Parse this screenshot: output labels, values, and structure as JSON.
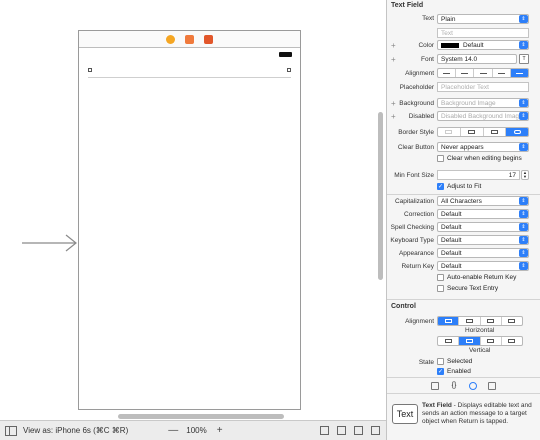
{
  "canvas": {
    "view_as_prefix": "View as:",
    "view_as_device": "iPhone 6s (⌘C ⌘R)",
    "zoom_out": "—",
    "zoom": "100%",
    "zoom_in": "+"
  },
  "inspector": {
    "text_field_title": "Text Field",
    "text_label": "Text",
    "text_value": "Plain",
    "text_placeholder": "Text",
    "color_label": "Color",
    "color_value": "Default",
    "font_label": "Font",
    "font_value": "System 14.0",
    "alignment_label": "Alignment",
    "placeholder_label": "Placeholder",
    "placeholder_hint": "Placeholder Text",
    "background_label": "Background",
    "background_value": "Background Image",
    "disabled_label": "Disabled",
    "disabled_value": "Disabled Background Image",
    "border_style_label": "Border Style",
    "clear_button_label": "Clear Button",
    "clear_button_value": "Never appears",
    "clear_when_editing": "Clear when editing begins",
    "min_font_size_label": "Min Font Size",
    "min_font_size_value": "17",
    "adjust_to_fit": "Adjust to Fit",
    "capitalization_label": "Capitalization",
    "capitalization_value": "All Characters",
    "correction_label": "Correction",
    "correction_value": "Default",
    "spell_checking_label": "Spell Checking",
    "spell_checking_value": "Default",
    "keyboard_type_label": "Keyboard Type",
    "keyboard_type_value": "Default",
    "appearance_label": "Appearance",
    "appearance_value": "Default",
    "return_key_label": "Return Key",
    "return_key_value": "Default",
    "auto_enable_return": "Auto-enable Return Key",
    "secure_text_entry": "Secure Text Entry",
    "control_title": "Control",
    "control_alignment_label": "Alignment",
    "horizontal_caption": "Horizontal",
    "vertical_caption": "Vertical",
    "state_label": "State",
    "selected": "Selected",
    "enabled": "Enabled"
  },
  "library": {
    "icon_text": "Text",
    "title": "Text Field",
    "description": " - Displays editable text and sends an action message to a target object when Return is tapped."
  },
  "colors": {
    "accent": "#2d7ff9",
    "color_swatch": "#000000"
  }
}
